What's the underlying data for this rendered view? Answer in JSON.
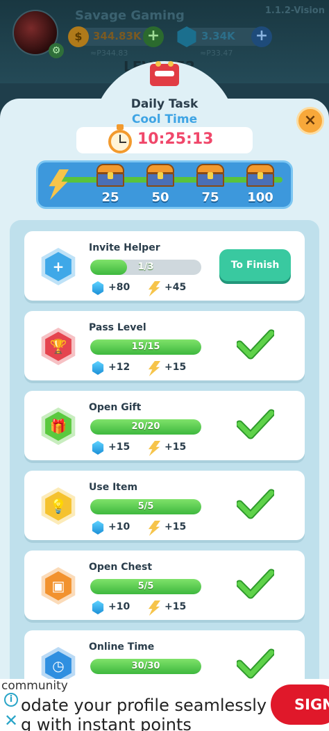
{
  "player": {
    "name": "Savage Gaming",
    "version": "1.1.2-Vision"
  },
  "resources": {
    "gold": {
      "value": "344.83K",
      "sub": "≈P344.83"
    },
    "gems": {
      "value": "3.34K",
      "sub": "≈P33.47"
    }
  },
  "level_peek": "LEVEL 52",
  "dialog": {
    "title": "Daily Task",
    "subtitle": "Cool Time",
    "close_icon": "×",
    "timer": "10:25:13"
  },
  "milestones": [
    "25",
    "50",
    "75",
    "100"
  ],
  "tasks": [
    {
      "name": "Invite Helper",
      "progress_text": "1/3",
      "progress": 0.3333,
      "gems": "+80",
      "bolts": "+45",
      "status": "To Finish",
      "color": "#3fa8e8",
      "icon": "person-add-icon"
    },
    {
      "name": "Pass Level",
      "progress_text": "15/15",
      "progress": 1,
      "gems": "+12",
      "bolts": "+15",
      "status": "done",
      "color": "#e5444e",
      "icon": "trophy-icon"
    },
    {
      "name": "Open Gift",
      "progress_text": "20/20",
      "progress": 1,
      "gems": "+15",
      "bolts": "+15",
      "status": "done",
      "color": "#5ac93e",
      "icon": "gift-icon"
    },
    {
      "name": "Use Item",
      "progress_text": "5/5",
      "progress": 1,
      "gems": "+10",
      "bolts": "+15",
      "status": "done",
      "color": "#f5c22e",
      "icon": "lightbulb-icon"
    },
    {
      "name": "Open Chest",
      "progress_text": "5/5",
      "progress": 1,
      "gems": "+10",
      "bolts": "+15",
      "status": "done",
      "color": "#f2922e",
      "icon": "chest-icon"
    },
    {
      "name": "Online Time",
      "progress_text": "30/30",
      "progress": 1,
      "gems": "",
      "bolts": "",
      "status": "done",
      "color": "#2f8fe0",
      "icon": "clock-icon"
    }
  ],
  "ad": {
    "community": "community",
    "line1": "odate your profile seamlessly",
    "line2": "g with instant points",
    "cta": "SIGN",
    "info_icon": "i",
    "close_icon": "✕"
  }
}
